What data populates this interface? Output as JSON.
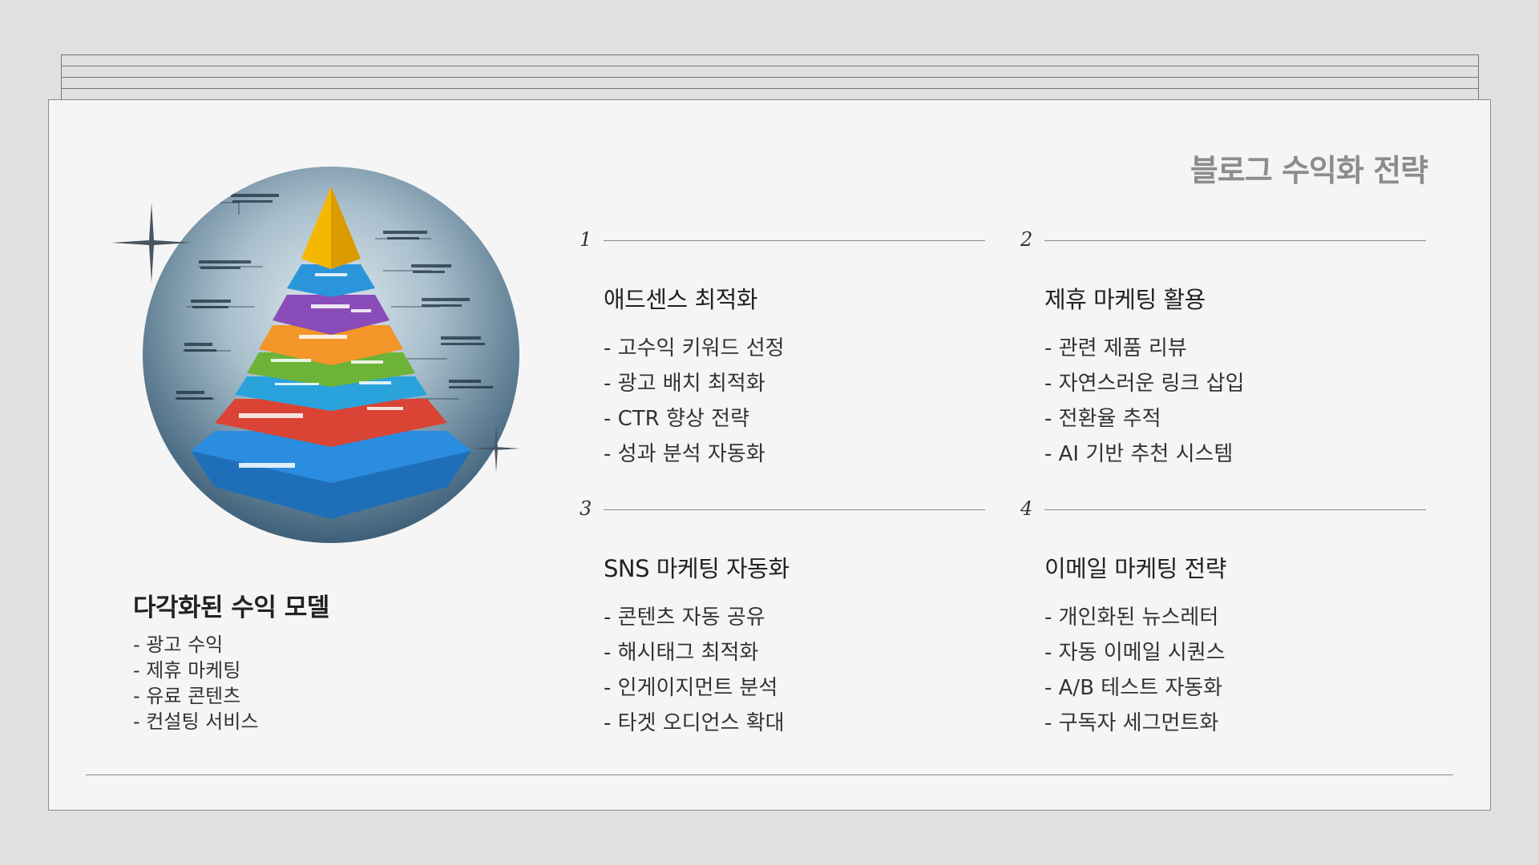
{
  "slide": {
    "title": "블로그 수익화 전략",
    "left": {
      "heading": "다각화된 수익 모델",
      "items": [
        "- 광고 수익",
        "- 제휴 마케팅",
        "- 유료 콘텐츠",
        "- 컨설팅 서비스"
      ]
    },
    "image": {
      "icon": "revenue-pyramid-illustration",
      "layer_colors": [
        "#f4b400",
        "#1e88d4",
        "#7b3fa6",
        "#f08c1c",
        "#5ea32e",
        "#1a9ad6",
        "#d43a2a",
        "#1f7fd0"
      ]
    },
    "blocks": [
      {
        "number": "1",
        "heading": "애드센스 최적화",
        "items": [
          "- 고수익 키워드 선정",
          "- 광고 배치 최적화",
          "- CTR 향상 전략",
          "- 성과 분석 자동화"
        ]
      },
      {
        "number": "2",
        "heading": "제휴 마케팅 활용",
        "items": [
          "- 관련 제품 리뷰",
          "- 자연스러운 링크 삽입",
          "- 전환율 추적",
          "- AI 기반 추천 시스템"
        ]
      },
      {
        "number": "3",
        "heading": "SNS 마케팅 자동화",
        "items": [
          "- 콘텐츠 자동 공유",
          "- 해시태그 최적화",
          "- 인게이지먼트 분석",
          "- 타겟 오디언스 확대"
        ]
      },
      {
        "number": "4",
        "heading": "이메일 마케팅 전략",
        "items": [
          "- 개인화된 뉴스레터",
          "- 자동 이메일 시퀀스",
          "- A/B 테스트 자동화",
          "- 구독자 세그먼트화"
        ]
      }
    ]
  }
}
